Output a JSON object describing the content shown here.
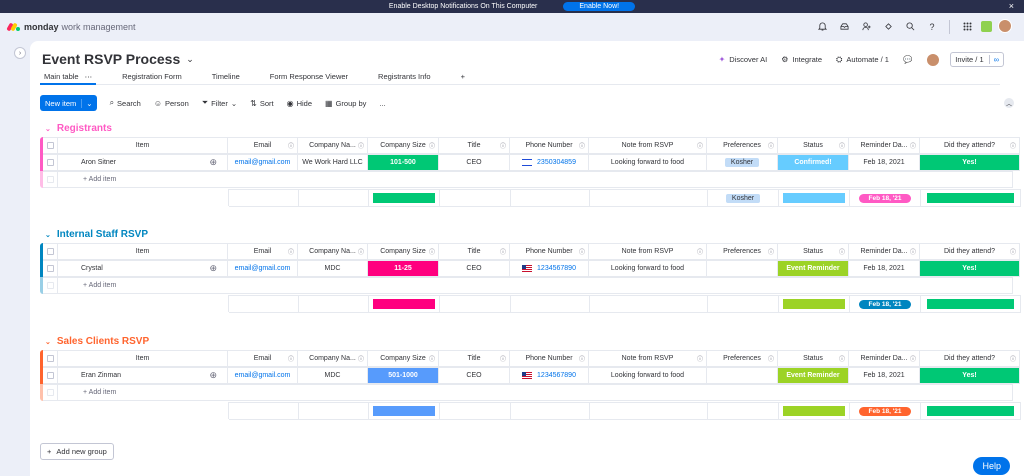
{
  "notification": {
    "text": "Enable Desktop Notifications On This Computer",
    "button": "Enable Now!",
    "close_icon": "×"
  },
  "app": {
    "brand": "monday",
    "product": "work management"
  },
  "board": {
    "title": "Event RSVP Process"
  },
  "header_actions": {
    "discover_ai": "Discover AI",
    "integrate": "Integrate",
    "automate": "Automate / 1",
    "invite": "Invite / 1"
  },
  "tabs": [
    "Main table",
    "Registration Form",
    "Timeline",
    "Form Response Viewer",
    "Registrants Info",
    "+"
  ],
  "toolbar": {
    "new_item": "New item",
    "search": "Search",
    "person": "Person",
    "filter": "Filter",
    "sort": "Sort",
    "hide": "Hide",
    "group_by": "Group by",
    "more": "..."
  },
  "columns": [
    "Item",
    "Email",
    "Company Na...",
    "Company Size",
    "Title",
    "Phone Number",
    "Note from RSVP",
    "Preferences",
    "Status",
    "Reminder Da...",
    "Did they attend?"
  ],
  "add_item_label": "+ Add item",
  "groups": [
    {
      "title": "Registrants",
      "color": "#ff5ac4",
      "row": {
        "item": "Aron Sitner",
        "email": "email@gmail.com",
        "company": "We Work Hard LLC",
        "size": "101-500",
        "size_color": "#00c875",
        "title": "CEO",
        "flag": "il",
        "phone": "2350304859",
        "note": "Looking forward to food",
        "pref": "Kosher",
        "status": "Confirmed!",
        "status_color": "#66ccff",
        "reminder": "Feb 18, 2021",
        "attend": "Yes!",
        "attend_color": "#00c875"
      },
      "summary": {
        "size_color": "#00c875",
        "pref": "Kosher",
        "status_color": "#66ccff",
        "date": "Feb 18, '21",
        "date_color": "#ff5ac4",
        "attend_color": "#00c875"
      }
    },
    {
      "title": "Internal Staff RSVP",
      "color": "#0086c0",
      "row": {
        "item": "Crystal",
        "email": "email@gmail.com",
        "company": "MDC",
        "size": "11-25",
        "size_color": "#ff007f",
        "title": "CEO",
        "flag": "us",
        "phone": "1234567890",
        "note": "Looking forward to food",
        "pref": "",
        "status": "Event Reminder",
        "status_color": "#9cd326",
        "reminder": "Feb 18, 2021",
        "attend": "Yes!",
        "attend_color": "#00c875"
      },
      "summary": {
        "size_color": "#ff007f",
        "pref": "",
        "status_color": "#9cd326",
        "date": "Feb 18, '21",
        "date_color": "#0086c0",
        "attend_color": "#00c875"
      }
    },
    {
      "title": "Sales Clients RSVP",
      "color": "#ff642e",
      "row": {
        "item": "Eran Zinman",
        "email": "email@gmail.com",
        "company": "MDC",
        "size": "501-1000",
        "size_color": "#579bfc",
        "title": "CEO",
        "flag": "us",
        "phone": "1234567890",
        "note": "Looking forward to food",
        "pref": "",
        "status": "Event Reminder",
        "status_color": "#9cd326",
        "reminder": "Feb 18, 2021",
        "attend": "Yes!",
        "attend_color": "#00c875"
      },
      "summary": {
        "size_color": "#579bfc",
        "pref": "",
        "status_color": "#9cd326",
        "date": "Feb 18, '21",
        "date_color": "#ff642e",
        "attend_color": "#00c875"
      }
    }
  ],
  "add_group": "Add new group",
  "help": "Help",
  "icons": {
    "bell": "bell-icon",
    "inbox": "inbox-icon",
    "invite": "invite-members-icon",
    "apps": "apps-icon",
    "search": "search-icon",
    "help": "help-icon",
    "grid": "apps-grid-icon"
  }
}
